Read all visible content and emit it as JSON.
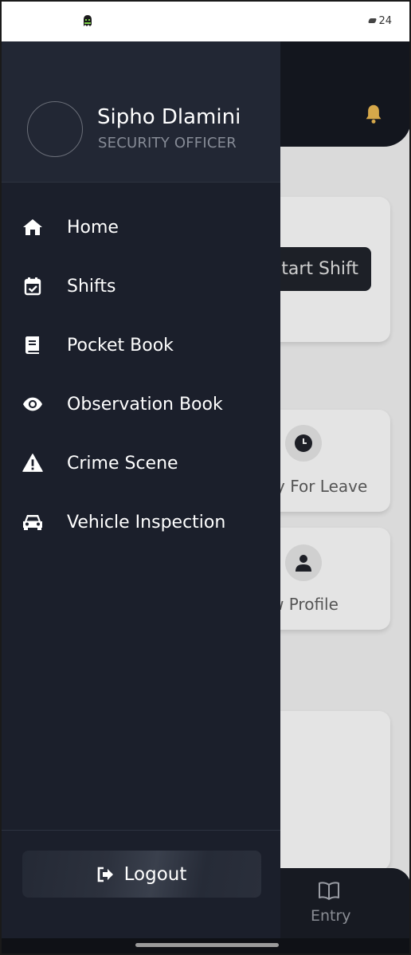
{
  "status_bar": {
    "time": "24"
  },
  "drawer": {
    "user": {
      "name": "Sipho Dlamini",
      "role": "SECURITY OFFICER"
    },
    "menu": [
      {
        "label": "Home",
        "icon": "home-icon"
      },
      {
        "label": "Shifts",
        "icon": "calendar-check-icon"
      },
      {
        "label": "Pocket Book",
        "icon": "book-icon"
      },
      {
        "label": "Observation Book",
        "icon": "eye-icon"
      },
      {
        "label": "Crime Scene",
        "icon": "warning-icon"
      },
      {
        "label": "Vehicle Inspection",
        "icon": "car-icon"
      }
    ],
    "logout_label": "Logout"
  },
  "background": {
    "start_shift_label": "Start Shift",
    "apply_leave_label": "y For Leave",
    "view_profile_label": "w Profile",
    "bottom_nav_entry_label": "Entry"
  },
  "colors": {
    "drawer_bg": "#1b1f2b",
    "drawer_header_bg": "#222734",
    "accent_bell": "#d6a84a"
  }
}
